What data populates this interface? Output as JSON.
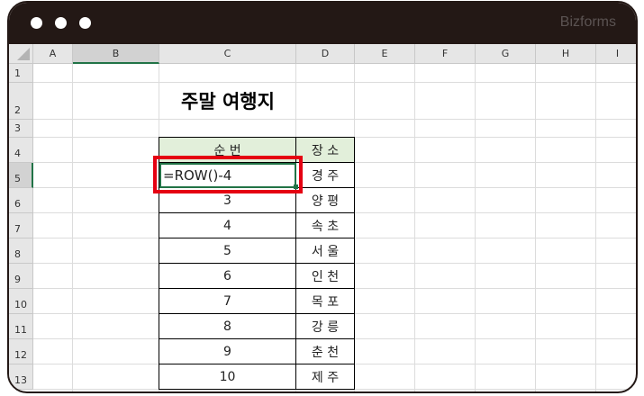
{
  "window": {
    "brand": "Bizforms"
  },
  "columns": [
    "A",
    "B",
    "C",
    "D",
    "E",
    "F",
    "G",
    "H",
    "I"
  ],
  "rows": [
    "1",
    "2",
    "3",
    "4",
    "5",
    "6",
    "7",
    "8",
    "9",
    "10",
    "11",
    "12",
    "13"
  ],
  "sheet": {
    "title": "주말 여행지",
    "headers": {
      "number": "순 번",
      "place": "장 소"
    },
    "entries": [
      {
        "number": "=ROW()-4",
        "place": "경 주"
      },
      {
        "number": "3",
        "place": "양 평"
      },
      {
        "number": "4",
        "place": "속 초"
      },
      {
        "number": "5",
        "place": "서 울"
      },
      {
        "number": "6",
        "place": "인 천"
      },
      {
        "number": "7",
        "place": "목 포"
      },
      {
        "number": "8",
        "place": "강 릉"
      },
      {
        "number": "9",
        "place": "춘 천"
      },
      {
        "number": "10",
        "place": "제 주"
      }
    ]
  },
  "colors": {
    "highlight": "#e50012",
    "header_fill": "#e2efda",
    "selection": "#217346"
  }
}
